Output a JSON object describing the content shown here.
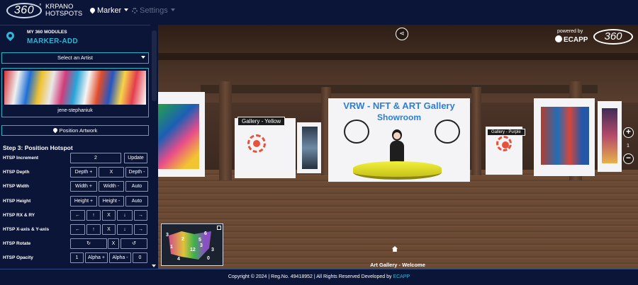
{
  "header": {
    "logo_text": "360",
    "logo_degree": "°",
    "brand_line1": "KRPANO",
    "brand_line2": "HOTSPOTS",
    "nav_marker": "Marker",
    "nav_settings": "Settings"
  },
  "sidebar": {
    "module_label": "MY 360 MODULES",
    "module_title": "MARKER-ADD",
    "artist_select": "Select an Artist",
    "artist_name": "jene-stephaniuk",
    "position_button": "Position Artwork",
    "step_title": "Step 3: Position Hotspot",
    "rows": [
      {
        "label": "HTSP Increment",
        "buttons": [
          "2",
          "Update"
        ]
      },
      {
        "label": "HTSP Depth",
        "buttons": [
          "Depth +",
          "X",
          "Depth -"
        ]
      },
      {
        "label": "HTSP Width",
        "buttons": [
          "Width +",
          "Width -",
          "Auto"
        ]
      },
      {
        "label": "HTSP Height",
        "buttons": [
          "Height +",
          "Height -",
          "Auto"
        ]
      },
      {
        "label": "HTSP RX & RY",
        "buttons": [
          "←",
          "↑",
          "X",
          "↓",
          "→"
        ]
      },
      {
        "label": "HTSP X-axis & Y-axis",
        "buttons": [
          "←",
          "↑",
          "X",
          "↓",
          "→"
        ]
      },
      {
        "label": "HTSP Rotate",
        "buttons": [
          "↻",
          "X",
          "↺"
        ]
      },
      {
        "label": "HTSP Opacity",
        "buttons": [
          "1",
          "Alpha +",
          "Alpha -",
          "0"
        ]
      }
    ]
  },
  "viewer": {
    "powered_by": "powered by",
    "ecapp": "ECAPP",
    "logo_text": "360",
    "showroom_title": "VRW - NFT & ART Gallery",
    "showroom_subtitle": "Showroom",
    "sign_left": "Gallery - Yellow",
    "sign_right": "Gallery - Purple",
    "zoom_in": "+",
    "zoom_out": "−",
    "zoom_value": "1",
    "scene_label": "Art Gallery - Welcome",
    "minimap_labels": [
      "3",
      "2",
      "6",
      "5",
      "1",
      "3",
      "12",
      "3",
      "4",
      "0"
    ]
  },
  "footer": {
    "text": "Copyright © 2024 |  Reg.No. 49418952 | All Rights Reserved  Developed by ",
    "link": "ECAPP"
  },
  "colors": {
    "background": "#0b1538",
    "accent": "#29b6d6",
    "hotspot": "#e8523a"
  }
}
